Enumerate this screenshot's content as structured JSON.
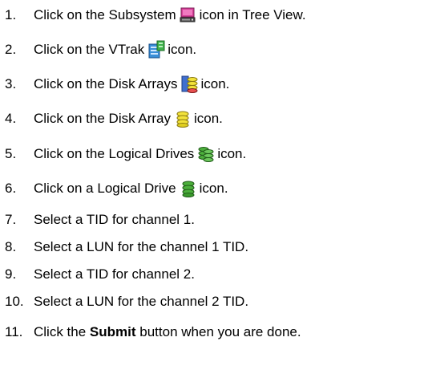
{
  "steps": [
    {
      "num": "1.",
      "before": "Click on the Subsystem",
      "icon": "subsystem-icon",
      "after": "icon in Tree View."
    },
    {
      "num": "2.",
      "before": "Click on the VTrak",
      "icon": "vtrak-icon",
      "after": "icon."
    },
    {
      "num": "3.",
      "before": "Click on the Disk Arrays",
      "icon": "disk-arrays-icon",
      "after": "icon."
    },
    {
      "num": "4.",
      "before": "Click on the Disk Array",
      "icon": "disk-array-icon",
      "after": "icon."
    },
    {
      "num": "5.",
      "before": "Click on the Logical Drives",
      "icon": "logical-drives-icon",
      "after": "icon."
    },
    {
      "num": "6.",
      "before": "Click on a Logical Drive",
      "icon": "logical-drive-icon",
      "after": "icon."
    },
    {
      "num": "7.",
      "text": "Select a TID for channel 1."
    },
    {
      "num": "8.",
      "text": "Select a LUN for the channel 1 TID."
    },
    {
      "num": "9.",
      "text": "Select a TID for channel 2."
    },
    {
      "num": "10.",
      "text": "Select a LUN for the channel 2 TID."
    },
    {
      "num": "11.",
      "before": "Click the",
      "bold": "Submit",
      "after": "button when you are done."
    }
  ],
  "colors": {
    "subsystem": "#d8409a",
    "vtrak": "#3a8fd8",
    "vtrak_accent": "#3fb24a",
    "disk_yellow": "#f2e23a",
    "disk_green": "#4caf3c",
    "disk_blue": "#3f6fd0"
  }
}
